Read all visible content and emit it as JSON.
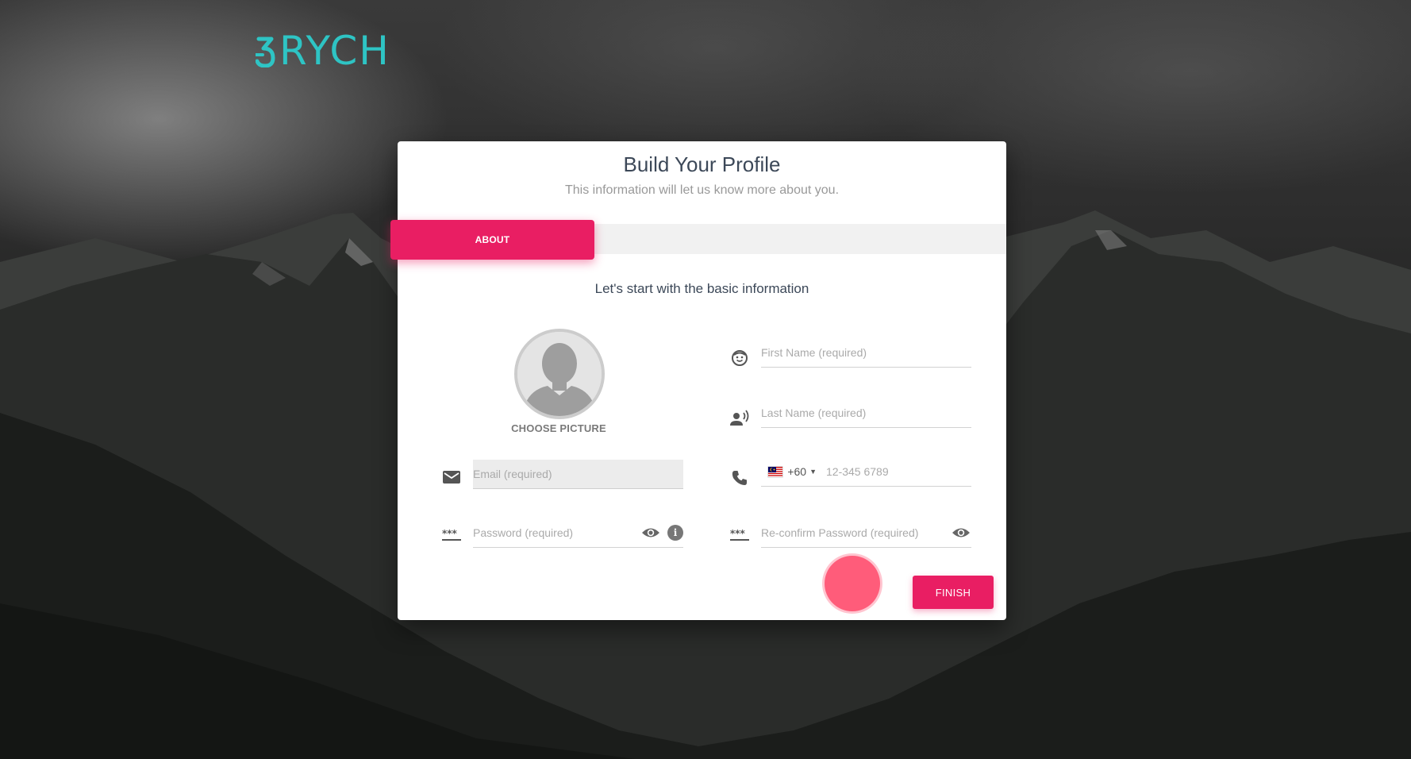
{
  "brand": {
    "logo_text": "RYCH",
    "color": "#2ec4c4"
  },
  "card": {
    "title": "Build Your Profile",
    "subtitle": "This information will let us know more about you."
  },
  "tabs": [
    {
      "label": "ABOUT",
      "active": true
    }
  ],
  "section": {
    "heading": "Let's start with the basic information"
  },
  "avatar": {
    "choose_label": "CHOOSE PICTURE"
  },
  "form": {
    "first_name": {
      "placeholder": "First Name (required)",
      "icon": "face-icon"
    },
    "last_name": {
      "placeholder": "Last Name (required)",
      "icon": "record-voice-icon"
    },
    "email": {
      "placeholder": "Email (required)",
      "icon": "mail-icon"
    },
    "phone": {
      "country_flag": "malaysia-flag-icon",
      "dial_code": "+60",
      "placeholder": "12-345 6789",
      "icon": "phone-icon"
    },
    "password": {
      "placeholder": "Password (required)",
      "icon": "password-icon"
    },
    "confirm_password": {
      "placeholder": "Re-confirm Password (required)",
      "icon": "password-icon"
    }
  },
  "actions": {
    "finish_label": "FINISH"
  },
  "colors": {
    "accent": "#e91e63",
    "ripple": "#ff5c7a"
  }
}
